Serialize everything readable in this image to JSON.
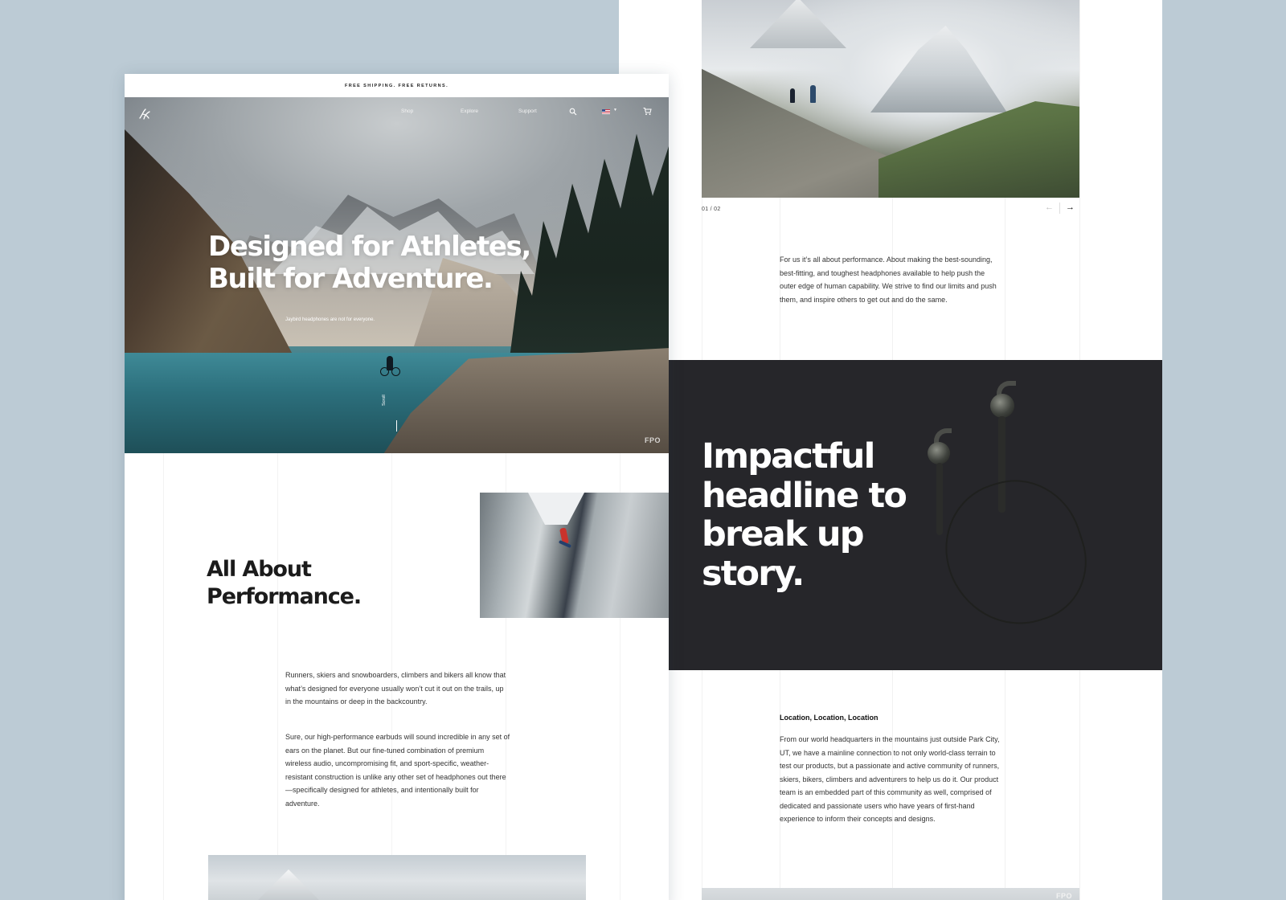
{
  "left_page": {
    "promo_bar": "FREE SHIPPING. FREE RETURNS.",
    "nav": {
      "logo": "jaybird-logo",
      "items": [
        {
          "label": "Shop"
        },
        {
          "label": "Explore"
        },
        {
          "label": "Support"
        }
      ],
      "icons": [
        "search-icon",
        "us-flag-icon",
        "cart-icon"
      ]
    },
    "hero": {
      "headline": "Designed for Athletes, Built for Adventure.",
      "subtitle": "Jaybird headphones are not for everyone.",
      "scroll_label": "Scroll",
      "fpo": "FPO"
    },
    "performance": {
      "title": "All About Performance.",
      "paragraph_1": "Runners, skiers and snowboarders, climbers and bikers all know that what’s designed for everyone usually won’t cut it out on the trails, up in the mountains or deep in the backcountry.",
      "paragraph_2": "Sure, our high-performance earbuds will sound incredible in any set of ears on the planet. But our fine-tuned combination of premium wireless audio, uncompromising fit, and sport-specific, weather-resistant construction is unlike any other set of headphones out there—specifically designed for athletes, and intentionally built for adventure."
    }
  },
  "right_page": {
    "slider": {
      "counter": "01 / 02",
      "prev_arrow": "←",
      "next_arrow": "→"
    },
    "intro_paragraph": "For us it’s all about performance. About making the best-sounding, best-fitting, and toughest headphones available to help push the outer edge of human capability. We strive to find our limits and push them, and inspire others to get out and do the same.",
    "dark_section": {
      "headline": "Impactful headline to break up story."
    },
    "location": {
      "title": "Location, Location, Location",
      "paragraph": "From our world headquarters in the mountains just outside Park City, UT, we have a mainline connection to not only world-class terrain to test our products, but a passionate and active community of runners, skiers, bikers, climbers and adventurers to help us do it. Our product team is an embedded part of this community as well, comprised of dedicated and passionate users who have years of first-hand experience to inform their concepts and designs."
    },
    "fpo": "FPO"
  },
  "colors": {
    "background": "#bccbd5",
    "dark_band": "#26262a",
    "text": "#1a1a1a"
  }
}
